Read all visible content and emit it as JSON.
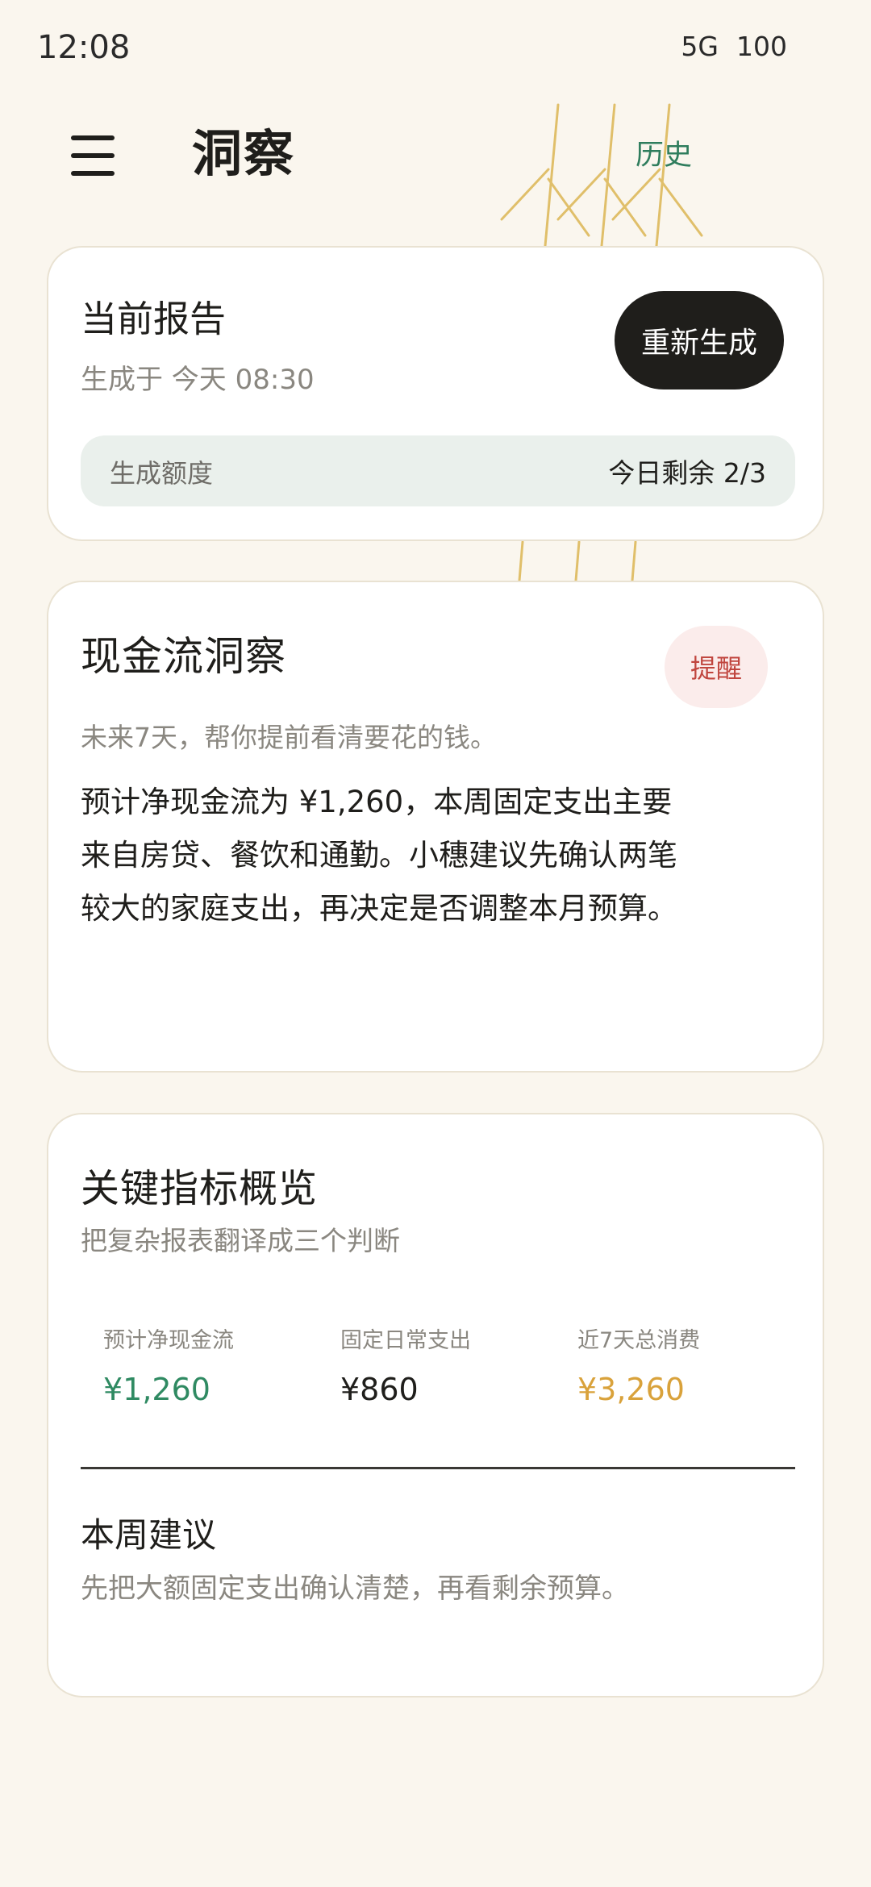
{
  "status_bar": {
    "time": "12:08",
    "network": "5G",
    "battery": "100"
  },
  "header": {
    "title": "洞察",
    "history_label": "历史",
    "menu_icon": "hamburger-menu-icon"
  },
  "current_report": {
    "title": "当前报告",
    "generated_at": "生成于 今天 08:30",
    "regenerate_label": "重新生成",
    "quota_label": "生成额度",
    "quota_value": "今日剩余 2/3"
  },
  "cashflow": {
    "title": "现金流洞察",
    "badge": "提醒",
    "subtitle": "未来7天，帮你提前看清要花的钱。",
    "body": "预计净现金流为 ¥1,260，本周固定支出主要来自房贷、餐饮和通勤。小穗建议先确认两笔较大的家庭支出，再决定是否调整本月预算。"
  },
  "kpi": {
    "title": "关键指标概览",
    "subtitle": "把复杂报表翻译成三个判断",
    "metrics": [
      {
        "label": "预计净现金流",
        "value": "¥1,260",
        "color": "#2f8a62"
      },
      {
        "label": "固定日常支出",
        "value": "¥860",
        "color": "#1f1e1b"
      },
      {
        "label": "近7天总消费",
        "value": "¥3,260",
        "color": "#d9a23b"
      }
    ],
    "week_title": "本周建议",
    "week_text": "先把大额固定支出确认清楚，再看剩余预算。"
  },
  "colors": {
    "background": "#faf6ee",
    "accent_green": "#2f7d5d",
    "alert_red": "#c0453e",
    "wheat_gold": "#e0bf6a"
  }
}
